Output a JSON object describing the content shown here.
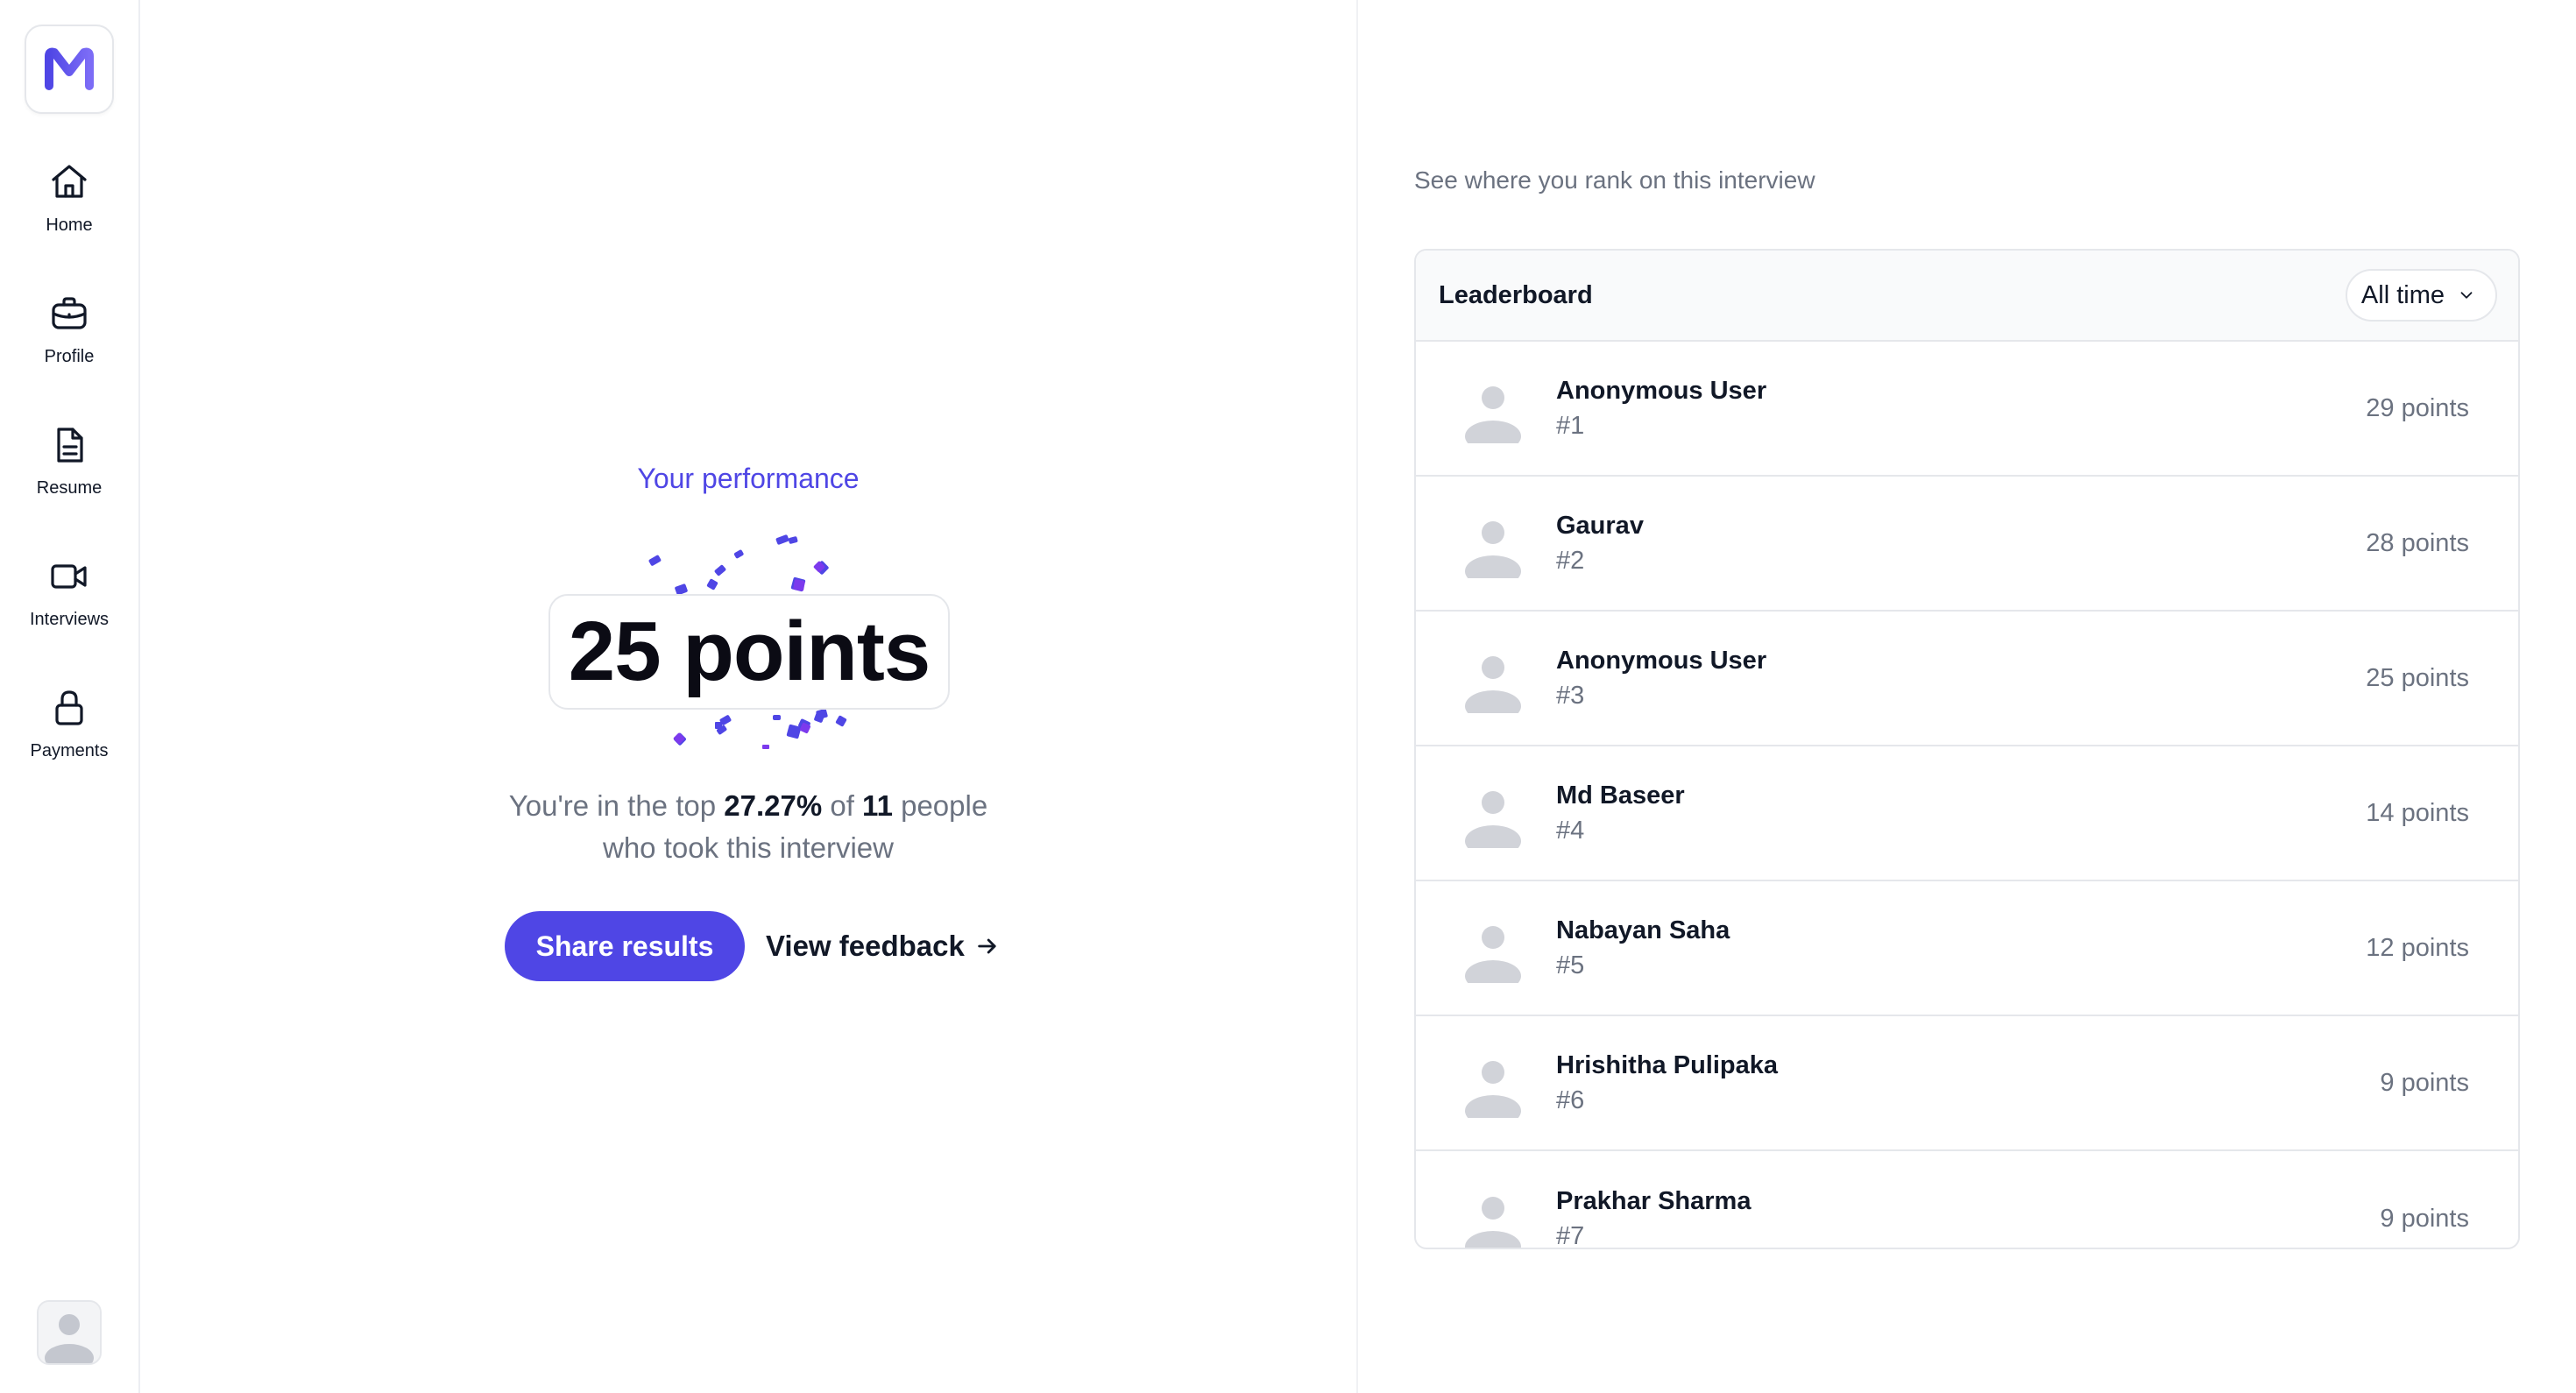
{
  "sidebar": {
    "logo_icon": "brand-m-logo",
    "items": [
      {
        "label": "Home",
        "icon": "home-icon"
      },
      {
        "label": "Profile",
        "icon": "briefcase-icon"
      },
      {
        "label": "Resume",
        "icon": "document-icon"
      },
      {
        "label": "Interviews",
        "icon": "video-camera-icon"
      },
      {
        "label": "Payments",
        "icon": "lock-icon"
      }
    ],
    "user_avatar_icon": "user-avatar-icon"
  },
  "performance": {
    "title": "Your performance",
    "points": "25 points",
    "rank_prefix": "You're in the top ",
    "rank_percent": "27.27%",
    "rank_mid": " of ",
    "rank_count": "11",
    "rank_suffix": " people",
    "rank_line2": "who took this interview",
    "share_label": "Share results",
    "feedback_label": "View feedback",
    "accent_color": "#4f46e5"
  },
  "leaderboard": {
    "subtitle": "See where you rank on this interview",
    "title": "Leaderboard",
    "filter_value": "All time",
    "rows": [
      {
        "name": "Anonymous User",
        "rank": "#1",
        "points": "29 points"
      },
      {
        "name": "Gaurav",
        "rank": "#2",
        "points": "28 points"
      },
      {
        "name": "Anonymous User",
        "rank": "#3",
        "points": "25 points"
      },
      {
        "name": "Md Baseer",
        "rank": "#4",
        "points": "14 points"
      },
      {
        "name": "Nabayan Saha",
        "rank": "#5",
        "points": "12 points"
      },
      {
        "name": "Hrishitha Pulipaka",
        "rank": "#6",
        "points": "9 points"
      },
      {
        "name": "Prakhar Sharma",
        "rank": "#7",
        "points": "9 points"
      }
    ]
  }
}
